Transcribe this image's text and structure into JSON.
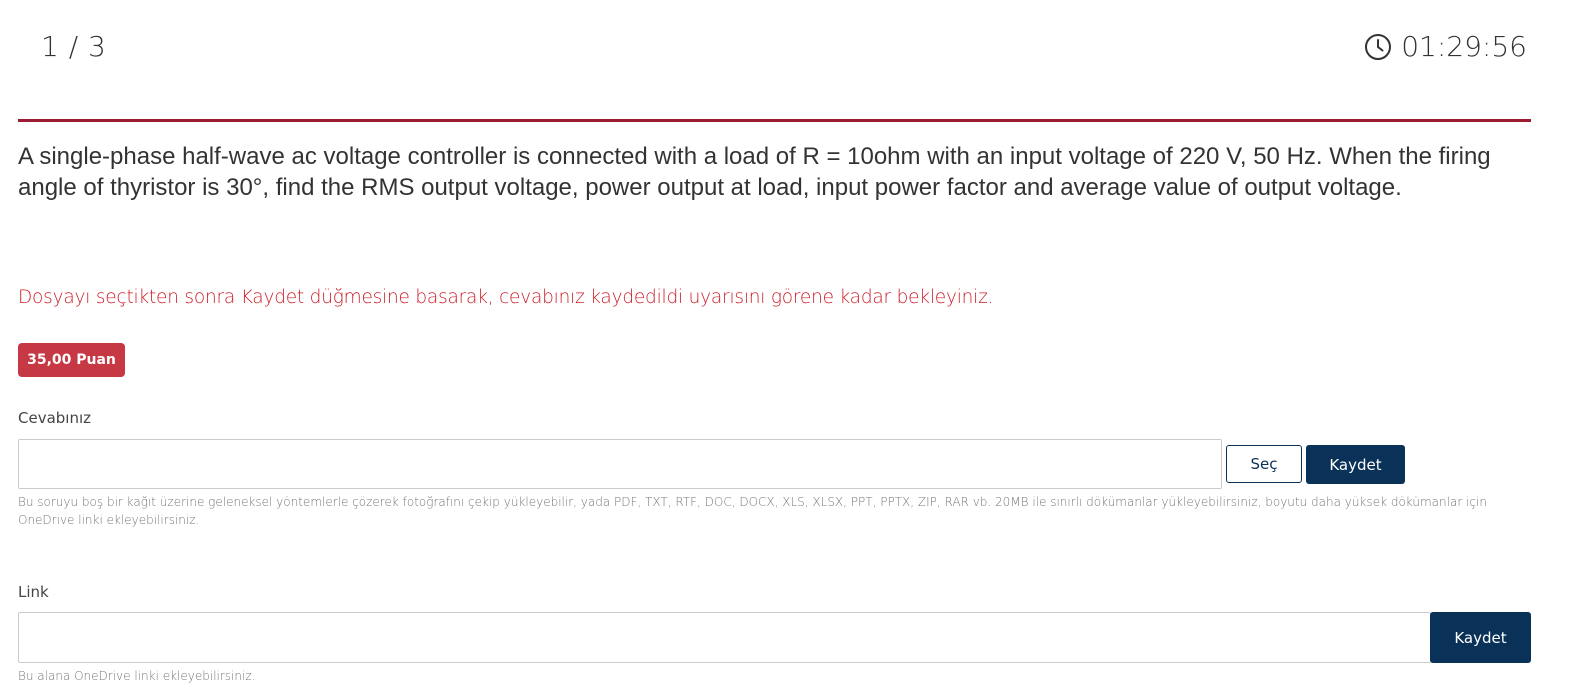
{
  "header": {
    "question_counter": "1 / 3",
    "timer_icon": "clock-icon",
    "timer_value": "01:29:56"
  },
  "question": {
    "text": "A single-phase half-wave ac voltage controller is connected with a load of R = 10ohm with an input voltage of 220 V, 50 Hz. When the firing angle of thyristor is 30°, find the RMS output voltage, power output at load, input power factor and average value of output voltage."
  },
  "warning": "Dosyayı seçtikten sonra Kaydet düğmesine basarak, cevabınız kaydedildi uyarısını görene kadar bekleyiniz.",
  "points_badge": "35,00 Puan",
  "answer_section": {
    "label": "Cevabınız",
    "file_value": "",
    "select_button": "Seç",
    "save_button": "Kaydet",
    "help_text": "Bu soruyu boş bir kağıt üzerine geleneksel yöntemlerle çözerek fotoğrafını çekip yükleyebilir, yada PDF, TXT, RTF, DOC, DOCX, XLS, XLSX, PPT, PPTX, ZIP, RAR vb. 20MB ile sınırlı dökümanlar yükleyebilirsiniz, boyutu daha yüksek dökümanlar için OneDrive linki ekleyebilirsiniz."
  },
  "link_section": {
    "label": "Link",
    "input_value": "",
    "save_button": "Kaydet",
    "help_text": "Bu alana OneDrive linki ekleyebilirsiniz."
  },
  "colors": {
    "accent_divider": "#9b1b30",
    "warning_text": "#cc1f2a",
    "badge_bg": "#c63843",
    "primary_button": "#0a3157"
  }
}
